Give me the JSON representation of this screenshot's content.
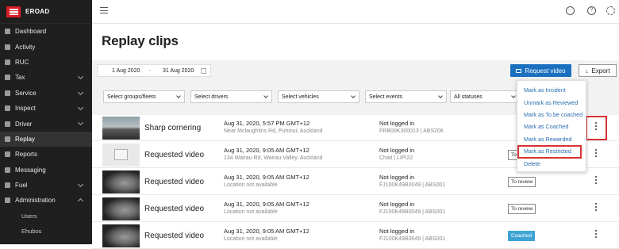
{
  "app": {
    "name": "EROAD"
  },
  "sidebar": {
    "items": [
      {
        "label": "Dashboard",
        "icon": "dashboard-icon",
        "chev": false
      },
      {
        "label": "Activity",
        "icon": "activity-icon",
        "chev": false
      },
      {
        "label": "RUC",
        "icon": "ruc-icon",
        "chev": false
      },
      {
        "label": "Tax",
        "icon": "tax-icon",
        "chev": true
      },
      {
        "label": "Service",
        "icon": "service-icon",
        "chev": true
      },
      {
        "label": "Inspect",
        "icon": "inspect-icon",
        "chev": true
      },
      {
        "label": "Driver",
        "icon": "driver-icon",
        "chev": true
      },
      {
        "label": "Replay",
        "icon": "replay-icon",
        "chev": false,
        "active": true
      },
      {
        "label": "Reports",
        "icon": "reports-icon",
        "chev": false
      },
      {
        "label": "Messaging",
        "icon": "messaging-icon",
        "chev": false
      },
      {
        "label": "Fuel",
        "icon": "fuel-icon",
        "chev": true
      },
      {
        "label": "Administration",
        "icon": "administration-icon",
        "chev": true,
        "open": true
      }
    ],
    "subitems": [
      "Users",
      "Ehubos"
    ]
  },
  "page": {
    "title": "Replay clips"
  },
  "dates": {
    "from": "1 Aug 2020",
    "sep": "-",
    "to": "31 Aug 2020"
  },
  "actions": {
    "request": "Request video",
    "export": "Export"
  },
  "filters": [
    "Select groups/fleets",
    "Select drivers",
    "Select vehicles",
    "Select events",
    "All statuses"
  ],
  "rows": [
    {
      "title": "Sharp cornering",
      "time": "Aug 31, 2020, 5:57 PM GMT+12",
      "loc": "Near Mclaughlins Rd, Puhinui, Auckland",
      "driver": "Not logged in",
      "vehicle": "FRB00K300013 | ABS206",
      "badge": "",
      "thumb": "road"
    },
    {
      "title": "Requested video",
      "time": "Aug 31, 2020, 9:05 AM GMT+12",
      "loc": "134 Wairau Rd, Wairau Valley, Auckland",
      "driver": "Not logged in",
      "vehicle": "Chait | LIPI22",
      "badge": "To",
      "thumb": "ph"
    },
    {
      "title": "Requested video",
      "time": "Aug 31, 2020, 9:05 AM GMT+12",
      "loc": "Location not available",
      "driver": "Not logged in",
      "vehicle": "FJ100K49B0049 | ABS001",
      "badge": "To review",
      "thumb": "dark"
    },
    {
      "title": "Requested video",
      "time": "Aug 31, 2020, 9:05 AM GMT+12",
      "loc": "Location not available",
      "driver": "Not logged in",
      "vehicle": "FJ100K49B0049 | ABS001",
      "badge": "To review",
      "thumb": "dark"
    },
    {
      "title": "Requested video",
      "time": "Aug 31, 2020, 9:05 AM GMT+12",
      "loc": "Location not available",
      "driver": "Not logged in",
      "vehicle": "FJ100K49B0049 | ABS001",
      "badge": "Coached",
      "thumb": "dark"
    }
  ],
  "menu": [
    "Mark as Incident",
    "Unmark as Reviewed",
    "Mark as To be coached",
    "Mark as Coached",
    "Mark as Rewarded",
    "Mark as Restricted",
    "Delete"
  ],
  "colors": {
    "primary": "#1a6fbf",
    "sidebar": "#1f1f1f",
    "brand": "#d71f26",
    "highlight": "#d63333",
    "coached": "#3fa3d6"
  }
}
